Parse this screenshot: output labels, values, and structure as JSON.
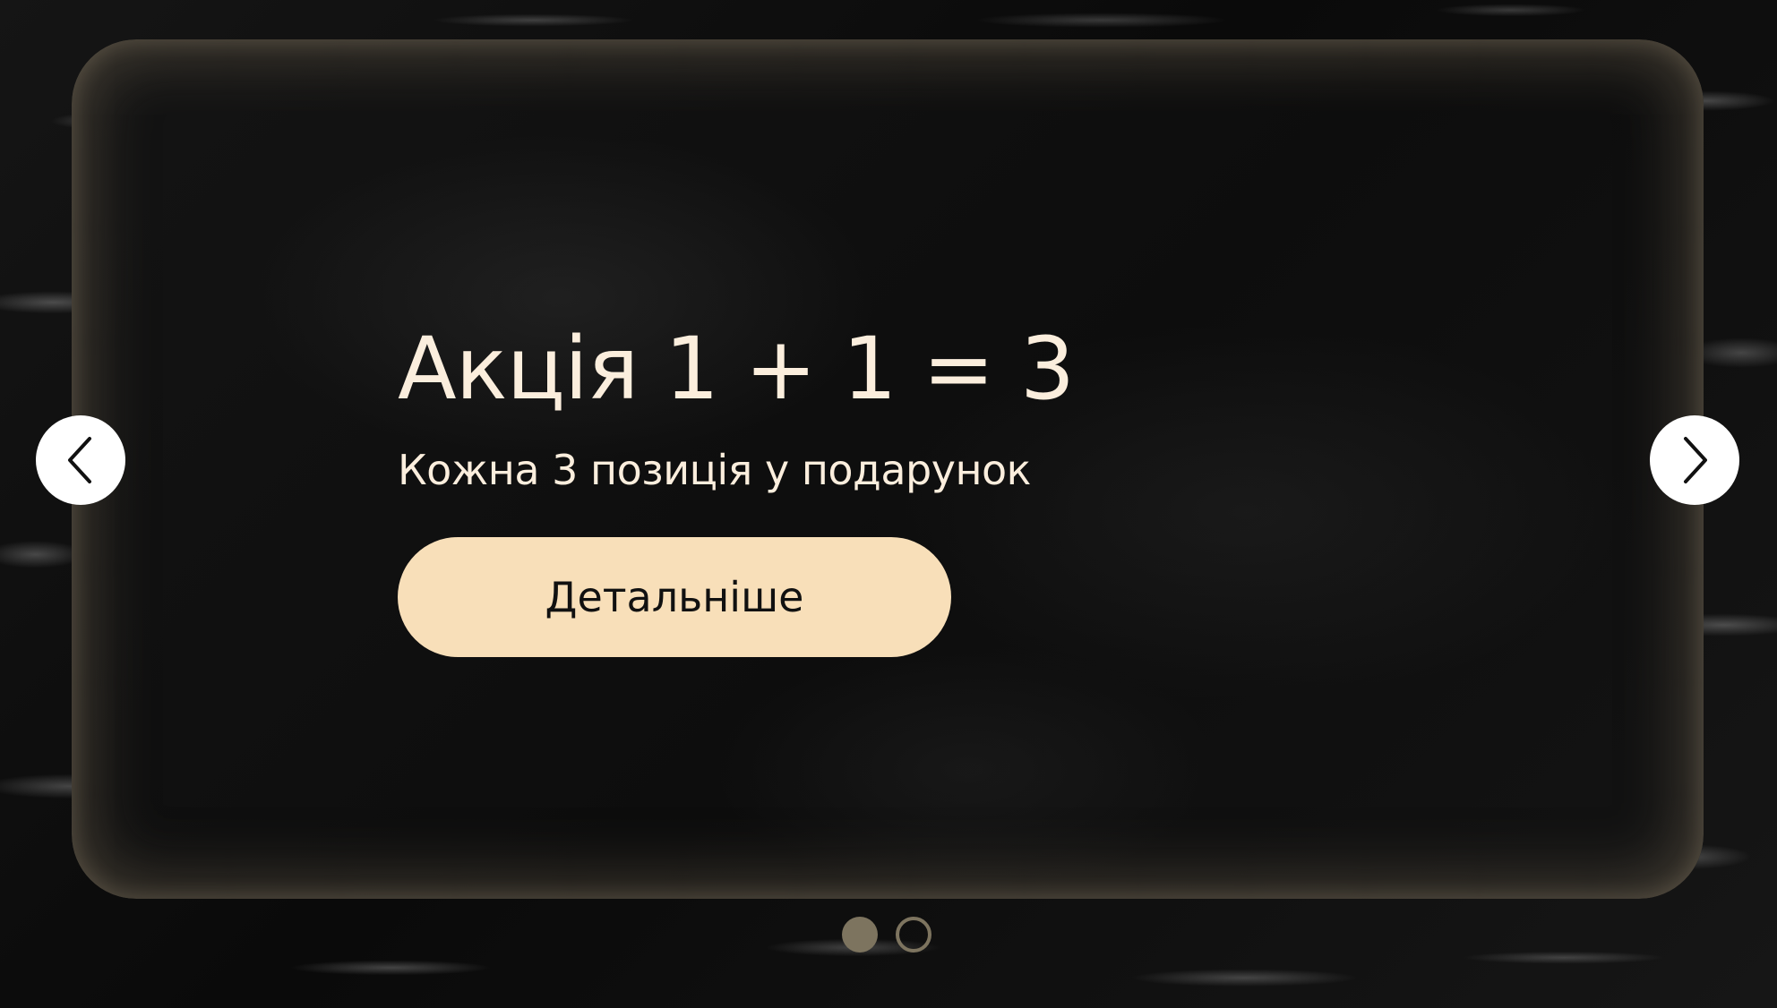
{
  "slider": {
    "slide": {
      "title": "Акція 1 + 1 = 3",
      "subtitle": "Кожна 3 позиція у подарунок",
      "button_label": "Детальніше"
    },
    "total_slides": 2,
    "active_slide": 1,
    "prev_icon": "chevron-left-icon",
    "next_icon": "chevron-right-icon"
  },
  "colors": {
    "text": "#fbeedd",
    "button_bg": "#f8dfb9",
    "button_text": "#111111",
    "dot": "#7d745f",
    "arrow_bg": "#ffffff"
  }
}
